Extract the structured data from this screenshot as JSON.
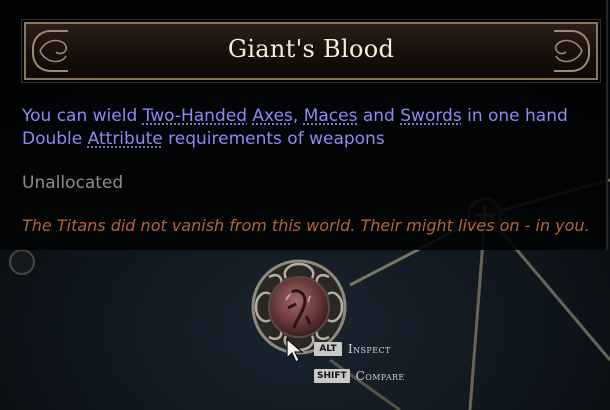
{
  "tooltip": {
    "title": "Giant's Blood",
    "stat1": {
      "prefix": "You can wield ",
      "kw1": "Two-Handed",
      "sep1": " ",
      "kw2": "Axes",
      "sep2": ", ",
      "kw3": "Maces",
      "sep3": " and ",
      "kw4": "Swords",
      "suffix": " in one hand"
    },
    "stat2": {
      "prefix": "Double ",
      "kw1": "Attribute",
      "suffix": " requirements of weapons"
    },
    "state": "Unallocated",
    "flavour": "The Titans did not vanish from this world. Their might lives on - in you."
  },
  "hints": [
    {
      "key": "ALT",
      "label": "Inspect"
    },
    {
      "key": "SHIFT",
      "label": "Compare"
    }
  ],
  "colors": {
    "stat": "#8d8bf2",
    "flavour": "#b7623a",
    "state": "#8e8e8e",
    "title": "#f6ecd9",
    "border": "#8a7560"
  },
  "icons": [
    "keystone-node-icon",
    "small-node-icon",
    "mouse-cursor-icon",
    "title-flourish-icon"
  ]
}
